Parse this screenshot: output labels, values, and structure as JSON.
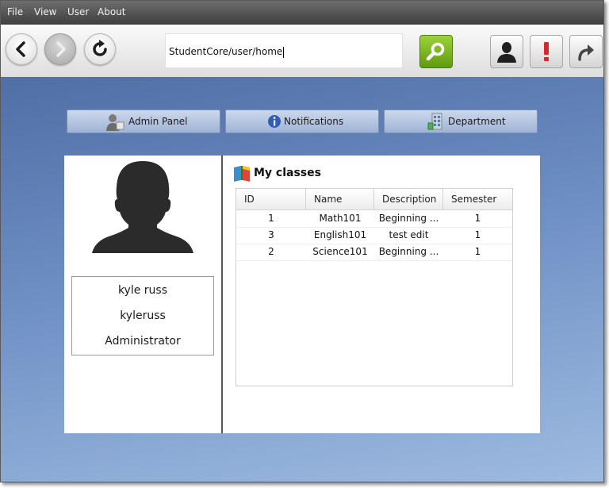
{
  "menu": [
    "File",
    "View",
    "User",
    "About"
  ],
  "toolbar": {
    "url": "StudentCore/user/home"
  },
  "nav": {
    "admin_panel": "Admin Panel",
    "notifications": "Notifications",
    "department": "Department"
  },
  "profile": {
    "full_name": "kyle russ",
    "username": "kyleruss",
    "role": "Administrator"
  },
  "classes": {
    "title": "My classes",
    "columns": [
      "ID",
      "Name",
      "Description",
      "Semester"
    ],
    "rows": [
      {
        "id": "1",
        "name": "Math101",
        "description": "Beginning ...",
        "semester": "1"
      },
      {
        "id": "3",
        "name": "English101",
        "description": "test edit",
        "semester": "1"
      },
      {
        "id": "2",
        "name": "Science101",
        "description": "Beginning ...",
        "semester": "1"
      }
    ]
  },
  "colors": {
    "menubar": "#4f4f4f",
    "go_button": "#7cb526",
    "alert_red": "#d8262a",
    "content_bg": "#6e8fc4"
  }
}
